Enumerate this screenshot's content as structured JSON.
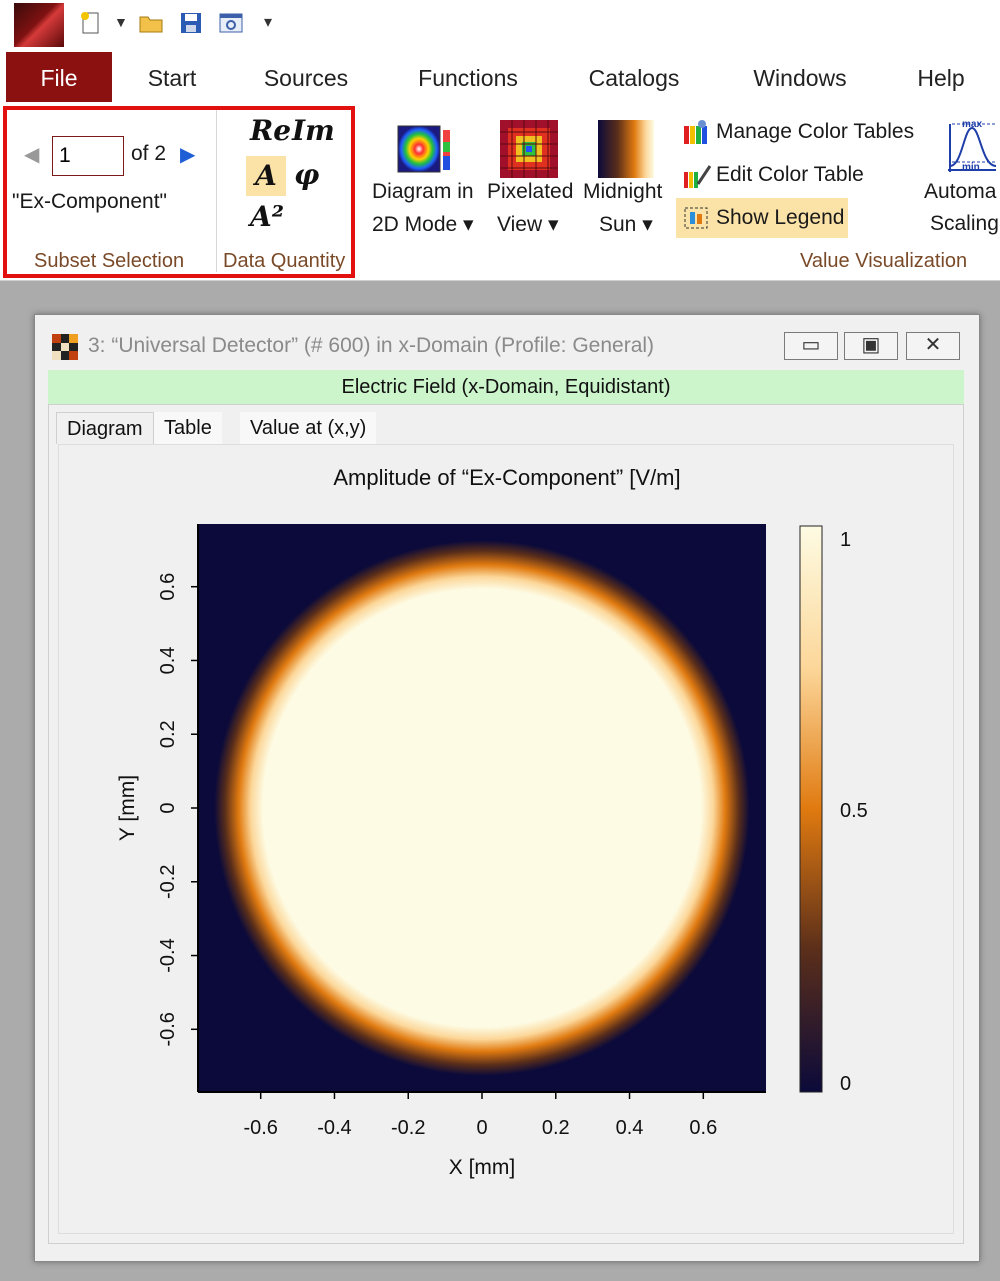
{
  "ribbon": {
    "tabs": [
      "File",
      "Start",
      "Sources",
      "Functions",
      "Catalogs",
      "Windows",
      "Help"
    ],
    "subset_selection": {
      "current": "1",
      "of_label": "of 2",
      "component": "\"Ex-Component\"",
      "group_label": "Subset Selection"
    },
    "data_quantity": {
      "re": "Re",
      "im": "Im",
      "amp": "A",
      "phase": "φ",
      "amp_sq": "A²",
      "group_label": "Data Quantity"
    },
    "value_visualization": {
      "diagram_line1": "Diagram in",
      "diagram_line2": "2D Mode ▾",
      "pixelated_line1": "Pixelated",
      "pixelated_line2": "View ▾",
      "midnight_line1": "Midnight",
      "midnight_line2": "Sun ▾",
      "manage": "Manage Color Tables",
      "edit": "Edit Color Table",
      "legend": "Show Legend",
      "auto_line1": "Automa",
      "auto_line2": "Scaling",
      "auto_max": "max",
      "auto_min": "min",
      "group_label": "Value Visualization"
    }
  },
  "window": {
    "title": "3: “Universal Detector” (# 600) in x-Domain (Profile: General)",
    "header": "Electric Field (x-Domain, Equidistant)",
    "tabs": [
      "Diagram",
      "Table",
      "Value at (x,y)"
    ]
  },
  "chart_data": {
    "type": "heatmap",
    "title": "Amplitude of “Ex-Component”   [V/m]",
    "xlabel": "X [mm]",
    "ylabel": "Y [mm]",
    "xlim": [
      -0.77,
      0.77
    ],
    "ylim": [
      -0.77,
      0.77
    ],
    "x_ticks": [
      "-0.6",
      "-0.4",
      "-0.2",
      "0",
      "0.2",
      "0.4",
      "0.6"
    ],
    "y_ticks": [
      "-0.6",
      "-0.4",
      "-0.2",
      "0",
      "0.2",
      "0.4",
      "0.6"
    ],
    "colorbar_ticks": [
      "0",
      "0.5",
      "1"
    ],
    "colorbar_range": [
      0,
      1
    ],
    "colormap": "Midnight Sun",
    "colormap_stops": [
      "#0b0a3a",
      "#5a2e1a",
      "#e07a10",
      "#fcd79a",
      "#fdfbe3"
    ],
    "field_shape": "circular top-hat",
    "plateau_radius": 0.66,
    "plateau_value": 1,
    "background_value": 0
  }
}
